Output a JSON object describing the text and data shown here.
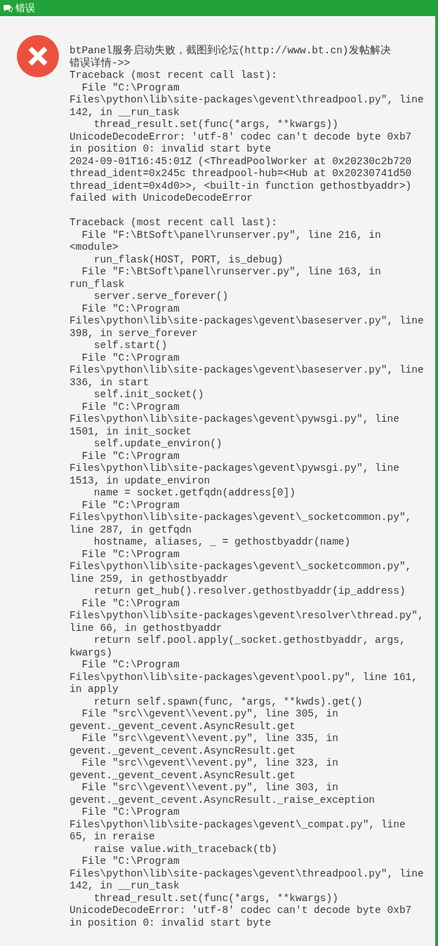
{
  "window": {
    "title": "错误"
  },
  "message": {
    "blocks": [
      [
        "btPanel服务启动失败，截图到论坛(http://www.bt.cn)发帖解决",
        "错误详情->>",
        "Traceback (most recent call last):",
        "  File \"C:\\Program",
        "Files\\python\\lib\\site-packages\\gevent\\threadpool.py\", line",
        "142, in __run_task",
        "    thread_result.set(func(*args, **kwargs))",
        "UnicodeDecodeError: 'utf-8' codec can't decode byte 0xb7",
        "in position 0: invalid start byte",
        "2024-09-01T16:45:01Z (<ThreadPoolWorker at 0x20230c2b720",
        "thread_ident=0x245c threadpool-hub=<Hub at 0x20230741d50",
        "thread_ident=0x4d0>>, <built-in function gethostbyaddr>)",
        "failed with UnicodeDecodeError"
      ],
      [
        "Traceback (most recent call last):",
        "  File \"F:\\BtSoft\\panel\\runserver.py\", line 216, in",
        "<module>",
        "    run_flask(HOST, PORT, is_debug)",
        "  File \"F:\\BtSoft\\panel\\runserver.py\", line 163, in",
        "run_flask",
        "    server.serve_forever()",
        "  File \"C:\\Program",
        "Files\\python\\lib\\site-packages\\gevent\\baseserver.py\", line",
        "398, in serve_forever",
        "    self.start()",
        "  File \"C:\\Program",
        "Files\\python\\lib\\site-packages\\gevent\\baseserver.py\", line",
        "336, in start",
        "    self.init_socket()",
        "  File \"C:\\Program",
        "Files\\python\\lib\\site-packages\\gevent\\pywsgi.py\", line",
        "1501, in init_socket",
        "    self.update_environ()",
        "  File \"C:\\Program",
        "Files\\python\\lib\\site-packages\\gevent\\pywsgi.py\", line",
        "1513, in update_environ",
        "    name = socket.getfqdn(address[0])",
        "  File \"C:\\Program",
        "Files\\python\\lib\\site-packages\\gevent\\_socketcommon.py\",",
        "line 287, in getfqdn",
        "    hostname, aliases, _ = gethostbyaddr(name)",
        "  File \"C:\\Program",
        "Files\\python\\lib\\site-packages\\gevent\\_socketcommon.py\",",
        "line 259, in gethostbyaddr",
        "    return get_hub().resolver.gethostbyaddr(ip_address)",
        "  File \"C:\\Program",
        "Files\\python\\lib\\site-packages\\gevent\\resolver\\thread.py\",",
        "line 66, in gethostbyaddr",
        "    return self.pool.apply(_socket.gethostbyaddr, args,",
        "kwargs)",
        "  File \"C:\\Program",
        "Files\\python\\lib\\site-packages\\gevent\\pool.py\", line 161,",
        "in apply",
        "    return self.spawn(func, *args, **kwds).get()",
        "  File \"src\\\\gevent\\\\event.py\", line 305, in",
        "gevent._gevent_cevent.AsyncResult.get",
        "  File \"src\\\\gevent\\\\event.py\", line 335, in",
        "gevent._gevent_cevent.AsyncResult.get",
        "  File \"src\\\\gevent\\\\event.py\", line 323, in",
        "gevent._gevent_cevent.AsyncResult.get",
        "  File \"src\\\\gevent\\\\event.py\", line 303, in",
        "gevent._gevent_cevent.AsyncResult._raise_exception",
        "  File \"C:\\Program",
        "Files\\python\\lib\\site-packages\\gevent\\_compat.py\", line",
        "65, in reraise",
        "    raise value.with_traceback(tb)",
        "  File \"C:\\Program",
        "Files\\python\\lib\\site-packages\\gevent\\threadpool.py\", line",
        "142, in __run_task",
        "    thread_result.set(func(*args, **kwargs))",
        "UnicodeDecodeError: 'utf-8' codec can't decode byte 0xb7",
        "in position 0: invalid start byte"
      ]
    ]
  }
}
